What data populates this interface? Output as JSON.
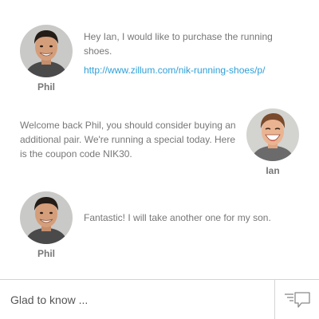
{
  "messages": [
    {
      "sender": "Phil",
      "text": "Hey Ian, I would like to purchase the running shoes.",
      "link": "http://www.zillum.com/nik-running-shoes/p/"
    },
    {
      "sender": "Ian",
      "text": "Welcome back Phil, you should consider buying an additional pair. We're running a special today. Here is the coupon code NIK30."
    },
    {
      "sender": "Phil",
      "text": "Fantastic! I will take another one for my son."
    }
  ],
  "composer": {
    "value": "Glad to know ...",
    "send_icon": "chat-send-icon"
  },
  "colors": {
    "text": "#777777",
    "link": "#2f9fd8",
    "divider": "#d4d4d4"
  }
}
